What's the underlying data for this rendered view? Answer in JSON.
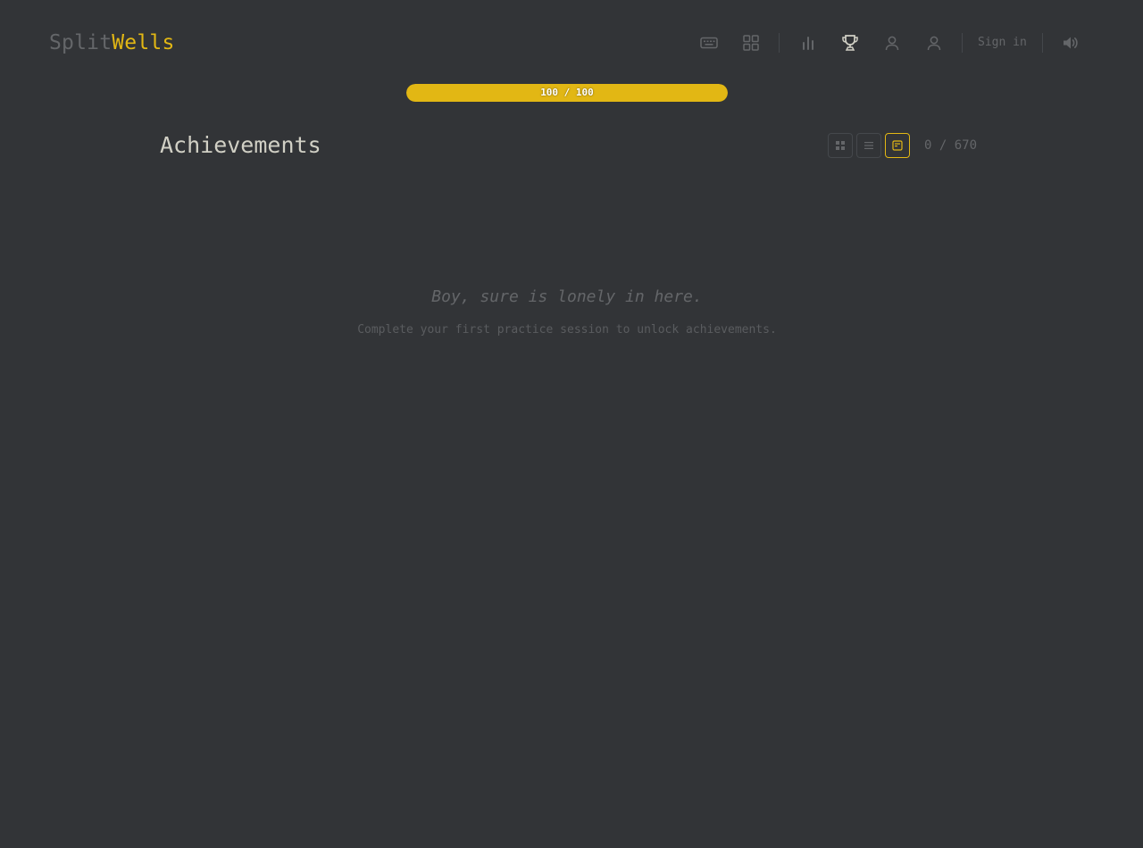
{
  "logo": {
    "part1": "Split",
    "part2": "Wells"
  },
  "nav": {
    "icons": [
      "keyboard-icon",
      "grid-icon",
      "bar-chart-icon",
      "trophy-icon",
      "user-icon",
      "user-icon",
      "volume-icon"
    ],
    "active": "trophy-icon",
    "sign_in_label": "Sign in"
  },
  "progress": {
    "label": "100 / 100",
    "value": 100,
    "max": 100
  },
  "page": {
    "title": "Achievements",
    "count": "0 / 670",
    "view_options": [
      "grid-view",
      "list-view",
      "card-view"
    ],
    "active_view": "card-view"
  },
  "empty_state": {
    "title": "Boy, sure is lonely in here.",
    "subtitle": "Complete your first practice session to unlock achievements."
  },
  "colors": {
    "background": "#323437",
    "accent": "#e2b714",
    "muted": "#646669",
    "text": "#d1d0c5"
  }
}
